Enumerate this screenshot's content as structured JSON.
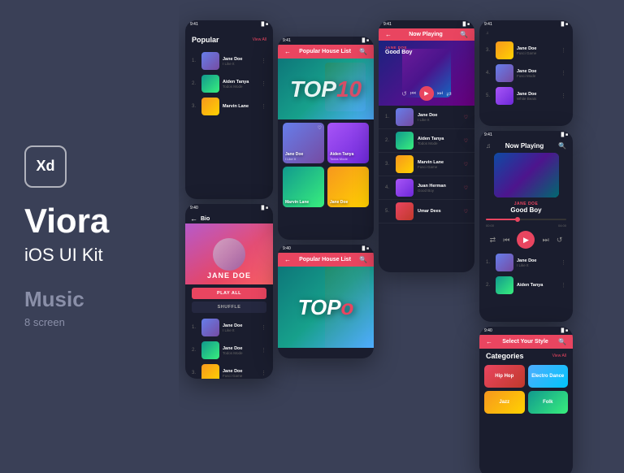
{
  "branding": {
    "badge": "Xd",
    "title": "Viora",
    "subtitle": "iOS UI Kit",
    "category": "Music",
    "screens": "8 screen"
  },
  "screens": {
    "popular": {
      "title": "Popular",
      "viewAll": "View All",
      "items": [
        {
          "num": "1.",
          "name": "Jane Doe",
          "artist": "I Like It",
          "thumb": "blue"
        },
        {
          "num": "2.",
          "name": "Aiden Tanya",
          "artist": "Todos Mode",
          "thumb": "green"
        },
        {
          "num": "3.",
          "name": "Marvin Lane",
          "artist": "",
          "thumb": "orange"
        }
      ]
    },
    "bio": {
      "back": "←",
      "label": "Bio",
      "artistName": "JANE DOE",
      "playAll": "PLAY ALL",
      "shuffle": "SHUFFLE",
      "items": [
        {
          "num": "1.",
          "name": "Jane Doe",
          "artist": "I Like It",
          "thumb": "blue"
        },
        {
          "num": "2.",
          "name": "Jane Doe",
          "artist": "Todos Mode",
          "thumb": "green"
        },
        {
          "num": "3.",
          "name": "Jane Doe",
          "artist": "Fusci Game",
          "thumb": "orange"
        }
      ]
    },
    "popularHouseTop": {
      "title": "Popular House List",
      "top10": "TOP10"
    },
    "popularHouseBottom": {
      "title": "Popular House List",
      "top10": "TOPo"
    },
    "artistGrid": {
      "artists": [
        {
          "name": "Jane Doe",
          "sub": "I Like It",
          "color": "blue"
        },
        {
          "name": "Aiden Tanya",
          "sub": "Todos Mode",
          "color": "purple"
        },
        {
          "name": "Marvin Lane",
          "sub": "",
          "color": "green"
        },
        {
          "name": "Jane Doe",
          "sub": "",
          "color": "cyan"
        }
      ]
    },
    "nowPlayingSmall": {
      "title": "Now Playing",
      "artist": "JANE DOE",
      "track": "Good Boy",
      "items": [
        {
          "num": "1.",
          "name": "Jane Doe",
          "artist": "I Like It",
          "thumb": "blue"
        },
        {
          "num": "2.",
          "name": "Aiden Tanya",
          "artist": "Todos Mode",
          "thumb": "green"
        },
        {
          "num": "3.",
          "name": "Marvin Lane",
          "artist": "Fusci Game",
          "thumb": "orange"
        },
        {
          "num": "4.",
          "name": "Juan Herman",
          "artist": "Good Boy",
          "thumb": "purple"
        },
        {
          "num": "5.",
          "name": "Umar Dees",
          "artist": "",
          "thumb": "red"
        }
      ]
    },
    "nowPlayingLarge": {
      "title": "Now Playing",
      "artist": "JANE DOE",
      "track": "Good Boy",
      "timeStart": "00:00",
      "timeEnd": "04:00",
      "items": [
        {
          "num": "1.",
          "name": "Jane Doe",
          "artist": "I Like It",
          "thumb": "blue"
        },
        {
          "num": "2.",
          "name": "Aiden Tanya",
          "artist": "",
          "thumb": "green"
        }
      ]
    },
    "popularSmall": {
      "items": [
        {
          "num": "3.",
          "name": "Jane Doe",
          "artist": "Fusci Game",
          "thumb": "orange"
        },
        {
          "num": "4.",
          "name": "Jane Doe",
          "artist": "Fusci Mode",
          "thumb": "blue"
        },
        {
          "num": "5.",
          "name": "Jane Doe",
          "artist": "White Beats",
          "thumb": "purple"
        }
      ]
    },
    "categories": {
      "selectStyle": "Select Your Style",
      "title": "Categories",
      "viewAll": "View All",
      "items": [
        {
          "name": "Hip Hop",
          "color": "red"
        },
        {
          "name": "Electro Dance",
          "color": "blue"
        },
        {
          "name": "Jazz",
          "color": "gold"
        },
        {
          "name": "Folk",
          "color": "green"
        }
      ]
    }
  },
  "colors": {
    "accent": "#e94560",
    "bg": "#1a1d2e",
    "surface": "#252840",
    "text": "#ffffff",
    "textMuted": "#888888",
    "bgPage": "#3a4057"
  }
}
